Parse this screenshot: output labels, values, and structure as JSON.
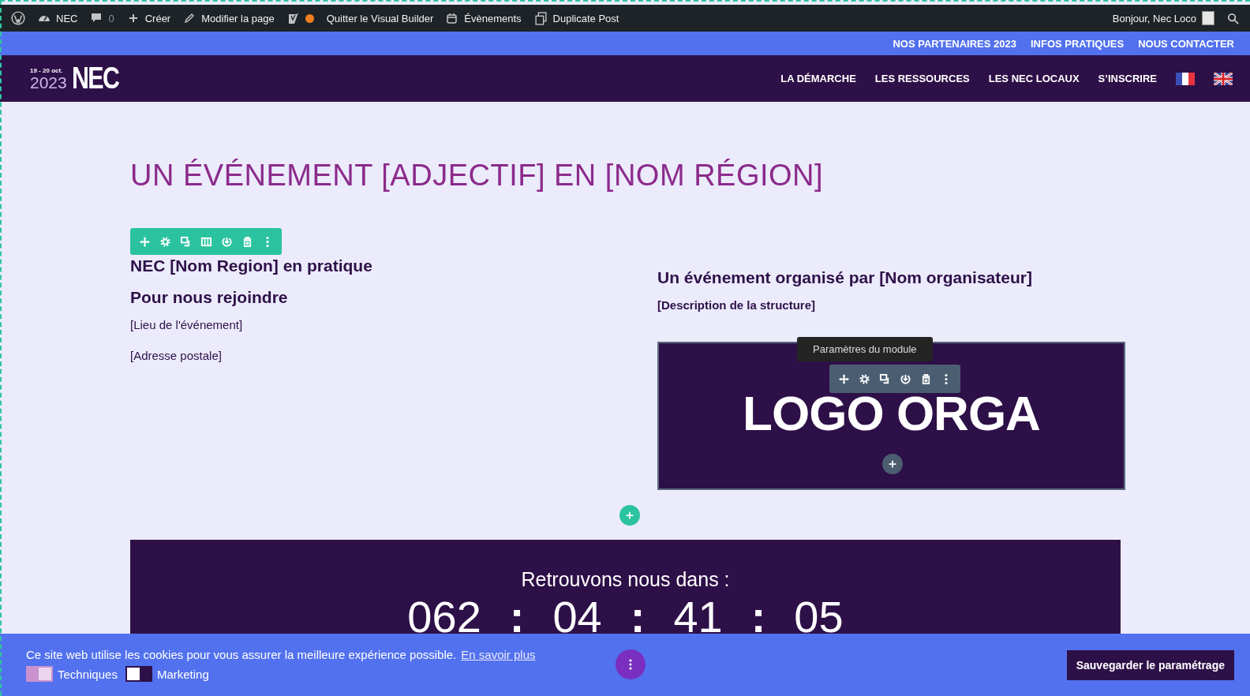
{
  "admin_bar": {
    "site": "NEC",
    "comments": "0",
    "new": "Créer",
    "edit": "Modifier la page",
    "exit": "Quitter le Visual Builder",
    "events": "Évènements",
    "duplicate": "Duplicate Post",
    "greeting": "Bonjour, Nec Loco"
  },
  "top_links": [
    "NOS PARTENAIRES 2023",
    "INFOS PRATIQUES",
    "NOUS CONTACTER"
  ],
  "logo": {
    "dates": "19 - 20 oct.",
    "year": "2023",
    "name": "NEC"
  },
  "nav": [
    "LA DÉMARCHE",
    "LES RESSOURCES",
    "LES NEC LOCAUX",
    "S’INSCRIRE"
  ],
  "page_title": "UN ÉVÉNEMENT [ADJECTIF] EN [NOM RÉGION]",
  "left_column": {
    "heading": "NEC [Nom Region] en pratique",
    "subheading": "Pour nous rejoindre",
    "paragraphs": [
      "[Lieu de l'événement]",
      "[Adresse postale]"
    ]
  },
  "right_column": {
    "heading": "Un événement organisé par [Nom organisateur]",
    "description": "[Description de la structure]",
    "logo_text": "LOGO ORGA",
    "tooltip": "Paramètres du module"
  },
  "countdown": {
    "title": "Retrouvons nous dans :",
    "items": [
      {
        "kind": "number",
        "text": "062"
      },
      {
        "kind": "separator",
        "text": ":"
      },
      {
        "kind": "number",
        "text": "04"
      },
      {
        "kind": "separator",
        "text": ":"
      },
      {
        "kind": "number",
        "text": "41"
      },
      {
        "kind": "separator",
        "text": ":"
      },
      {
        "kind": "number",
        "text": "05"
      }
    ]
  },
  "cookie_banner": {
    "message": "Ce site web utilise les cookies pour vous assurer la meilleure expérience possible.",
    "link": "En savoir plus",
    "toggles": [
      {
        "label": "Techniques",
        "checked": true
      },
      {
        "label": "Marketing",
        "checked": false
      }
    ],
    "button": "Sauvegarder le paramétrage"
  }
}
